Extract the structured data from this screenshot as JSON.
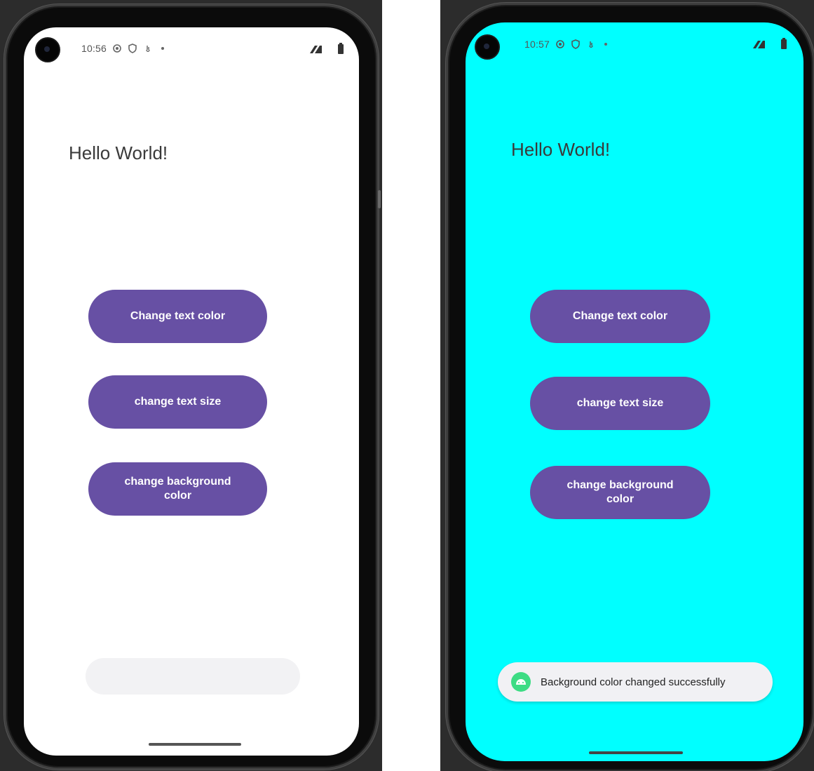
{
  "screens": [
    {
      "status": {
        "time": "10:56"
      },
      "hello_text": "Hello World!",
      "buttons": {
        "change_text_color": "Change text color",
        "change_text_size": "change text size",
        "change_background_color": "change background color"
      },
      "background_color": "#ffffff",
      "toast": {
        "visible": false,
        "message": ""
      }
    },
    {
      "status": {
        "time": "10:57"
      },
      "hello_text": "Hello World!",
      "buttons": {
        "change_text_color": "Change text color",
        "change_text_size": "change text size",
        "change_background_color": "change background color"
      },
      "background_color": "#00ffff",
      "toast": {
        "visible": true,
        "message": "Background color changed successfully"
      }
    }
  ],
  "colors": {
    "button": "#6750a4",
    "button_text": "#ffffff",
    "android_icon": "#3ddc84"
  },
  "icons": [
    "front-camera",
    "settings-icon",
    "shield-icon",
    "hand-icon",
    "notification-dot",
    "network-icon",
    "battery-icon",
    "android-icon"
  ]
}
